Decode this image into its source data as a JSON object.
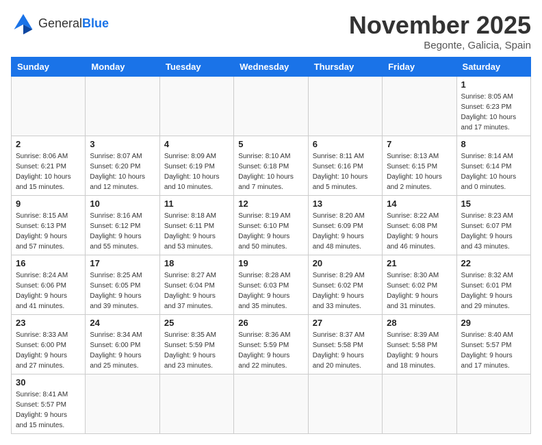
{
  "header": {
    "logo_general": "General",
    "logo_blue": "Blue",
    "month_title": "November 2025",
    "location": "Begonte, Galicia, Spain"
  },
  "days_of_week": [
    "Sunday",
    "Monday",
    "Tuesday",
    "Wednesday",
    "Thursday",
    "Friday",
    "Saturday"
  ],
  "weeks": [
    [
      {
        "day": "",
        "info": ""
      },
      {
        "day": "",
        "info": ""
      },
      {
        "day": "",
        "info": ""
      },
      {
        "day": "",
        "info": ""
      },
      {
        "day": "",
        "info": ""
      },
      {
        "day": "",
        "info": ""
      },
      {
        "day": "1",
        "info": "Sunrise: 8:05 AM\nSunset: 6:23 PM\nDaylight: 10 hours\nand 17 minutes."
      }
    ],
    [
      {
        "day": "2",
        "info": "Sunrise: 8:06 AM\nSunset: 6:21 PM\nDaylight: 10 hours\nand 15 minutes."
      },
      {
        "day": "3",
        "info": "Sunrise: 8:07 AM\nSunset: 6:20 PM\nDaylight: 10 hours\nand 12 minutes."
      },
      {
        "day": "4",
        "info": "Sunrise: 8:09 AM\nSunset: 6:19 PM\nDaylight: 10 hours\nand 10 minutes."
      },
      {
        "day": "5",
        "info": "Sunrise: 8:10 AM\nSunset: 6:18 PM\nDaylight: 10 hours\nand 7 minutes."
      },
      {
        "day": "6",
        "info": "Sunrise: 8:11 AM\nSunset: 6:16 PM\nDaylight: 10 hours\nand 5 minutes."
      },
      {
        "day": "7",
        "info": "Sunrise: 8:13 AM\nSunset: 6:15 PM\nDaylight: 10 hours\nand 2 minutes."
      },
      {
        "day": "8",
        "info": "Sunrise: 8:14 AM\nSunset: 6:14 PM\nDaylight: 10 hours\nand 0 minutes."
      }
    ],
    [
      {
        "day": "9",
        "info": "Sunrise: 8:15 AM\nSunset: 6:13 PM\nDaylight: 9 hours\nand 57 minutes."
      },
      {
        "day": "10",
        "info": "Sunrise: 8:16 AM\nSunset: 6:12 PM\nDaylight: 9 hours\nand 55 minutes."
      },
      {
        "day": "11",
        "info": "Sunrise: 8:18 AM\nSunset: 6:11 PM\nDaylight: 9 hours\nand 53 minutes."
      },
      {
        "day": "12",
        "info": "Sunrise: 8:19 AM\nSunset: 6:10 PM\nDaylight: 9 hours\nand 50 minutes."
      },
      {
        "day": "13",
        "info": "Sunrise: 8:20 AM\nSunset: 6:09 PM\nDaylight: 9 hours\nand 48 minutes."
      },
      {
        "day": "14",
        "info": "Sunrise: 8:22 AM\nSunset: 6:08 PM\nDaylight: 9 hours\nand 46 minutes."
      },
      {
        "day": "15",
        "info": "Sunrise: 8:23 AM\nSunset: 6:07 PM\nDaylight: 9 hours\nand 43 minutes."
      }
    ],
    [
      {
        "day": "16",
        "info": "Sunrise: 8:24 AM\nSunset: 6:06 PM\nDaylight: 9 hours\nand 41 minutes."
      },
      {
        "day": "17",
        "info": "Sunrise: 8:25 AM\nSunset: 6:05 PM\nDaylight: 9 hours\nand 39 minutes."
      },
      {
        "day": "18",
        "info": "Sunrise: 8:27 AM\nSunset: 6:04 PM\nDaylight: 9 hours\nand 37 minutes."
      },
      {
        "day": "19",
        "info": "Sunrise: 8:28 AM\nSunset: 6:03 PM\nDaylight: 9 hours\nand 35 minutes."
      },
      {
        "day": "20",
        "info": "Sunrise: 8:29 AM\nSunset: 6:02 PM\nDaylight: 9 hours\nand 33 minutes."
      },
      {
        "day": "21",
        "info": "Sunrise: 8:30 AM\nSunset: 6:02 PM\nDaylight: 9 hours\nand 31 minutes."
      },
      {
        "day": "22",
        "info": "Sunrise: 8:32 AM\nSunset: 6:01 PM\nDaylight: 9 hours\nand 29 minutes."
      }
    ],
    [
      {
        "day": "23",
        "info": "Sunrise: 8:33 AM\nSunset: 6:00 PM\nDaylight: 9 hours\nand 27 minutes."
      },
      {
        "day": "24",
        "info": "Sunrise: 8:34 AM\nSunset: 6:00 PM\nDaylight: 9 hours\nand 25 minutes."
      },
      {
        "day": "25",
        "info": "Sunrise: 8:35 AM\nSunset: 5:59 PM\nDaylight: 9 hours\nand 23 minutes."
      },
      {
        "day": "26",
        "info": "Sunrise: 8:36 AM\nSunset: 5:59 PM\nDaylight: 9 hours\nand 22 minutes."
      },
      {
        "day": "27",
        "info": "Sunrise: 8:37 AM\nSunset: 5:58 PM\nDaylight: 9 hours\nand 20 minutes."
      },
      {
        "day": "28",
        "info": "Sunrise: 8:39 AM\nSunset: 5:58 PM\nDaylight: 9 hours\nand 18 minutes."
      },
      {
        "day": "29",
        "info": "Sunrise: 8:40 AM\nSunset: 5:57 PM\nDaylight: 9 hours\nand 17 minutes."
      }
    ],
    [
      {
        "day": "30",
        "info": "Sunrise: 8:41 AM\nSunset: 5:57 PM\nDaylight: 9 hours\nand 15 minutes."
      },
      {
        "day": "",
        "info": ""
      },
      {
        "day": "",
        "info": ""
      },
      {
        "day": "",
        "info": ""
      },
      {
        "day": "",
        "info": ""
      },
      {
        "day": "",
        "info": ""
      },
      {
        "day": "",
        "info": ""
      }
    ]
  ]
}
